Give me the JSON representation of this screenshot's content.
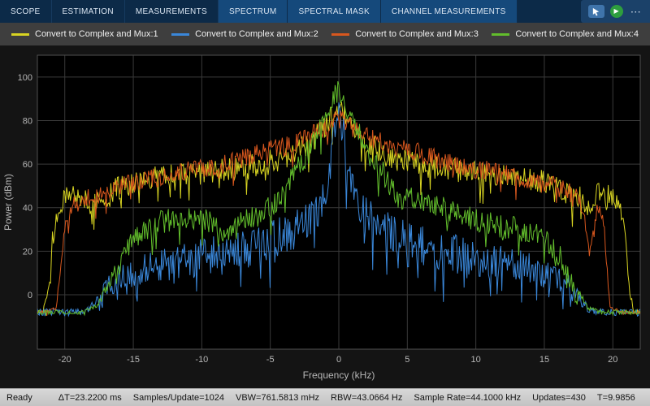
{
  "tabs": [
    "SCOPE",
    "ESTIMATION",
    "MEASUREMENTS",
    "SPECTRUM",
    "SPECTRAL MASK",
    "CHANNEL MEASUREMENTS"
  ],
  "toolbar": {
    "play_glyph": "▶",
    "more_glyph": "⋯",
    "icons": [
      "pointer-badge-icon",
      "run-play-icon",
      "more-options-icon"
    ]
  },
  "legend": [
    {
      "label": "Convert to Complex and Mux:1",
      "color": "#d8d422"
    },
    {
      "label": "Convert to Complex and Mux:2",
      "color": "#3a87d9"
    },
    {
      "label": "Convert to Complex and Mux:3",
      "color": "#d8571e"
    },
    {
      "label": "Convert to Complex and Mux:4",
      "color": "#62bd2c"
    }
  ],
  "status": {
    "ready": "Ready",
    "items": [
      "ΔT=23.2200 ms",
      "Samples/Update=1024",
      "VBW=761.5813 mHz",
      "RBW=43.0664 Hz",
      "Sample Rate=44.1000 kHz",
      "Updates=430",
      "T=9.9856"
    ]
  },
  "chart_data": {
    "type": "line",
    "title": "",
    "xlabel": "Frequency (kHz)",
    "ylabel": "Power (dBm)",
    "xlim": [
      -22,
      22
    ],
    "ylim": [
      -25,
      110
    ],
    "xticks": [
      -20,
      -15,
      -10,
      -5,
      0,
      5,
      10,
      15,
      20
    ],
    "yticks": [
      0,
      20,
      40,
      60,
      80,
      100
    ],
    "grid": true,
    "legend_position": "top",
    "colors": {
      "figure_bg": "#141414",
      "axes_bg": "#000000",
      "grid": "#3a3a3a",
      "tick_text": "#b6b6b6",
      "border": "#4f4f4f"
    },
    "series": [
      {
        "name": "Convert to Complex and Mux:1",
        "color": "#d8d422",
        "noise": 5.5,
        "x": [
          -22,
          -21.6,
          -21.2,
          -20.9,
          -20.5,
          -20,
          -19.5,
          -19,
          -18.5,
          -18,
          -17.5,
          -17,
          -16.3,
          -15.6,
          -14.9,
          -14.2,
          -13.5,
          -12.8,
          -12.1,
          -11.4,
          -10.7,
          -10,
          -9.3,
          -8.6,
          -7.9,
          -7.2,
          -6.5,
          -5.8,
          -5.1,
          -4.5,
          -3.9,
          -3.3,
          -2.8,
          -2.3,
          -1.9,
          -1.5,
          -1.1,
          -0.8,
          -0.5,
          -0.25,
          0,
          0.25,
          0.5,
          0.8,
          1.1,
          1.5,
          1.9,
          2.3,
          2.8,
          3.3,
          3.9,
          4.5,
          5.1,
          5.8,
          6.5,
          7.2,
          7.9,
          8.6,
          9.3,
          10,
          10.7,
          11.4,
          12.1,
          12.8,
          13.5,
          14.2,
          14.9,
          15.6,
          16.3,
          17,
          17.5,
          18,
          18.5,
          19,
          19.5,
          20,
          20.5,
          20.9,
          21.2,
          21.6,
          22
        ],
        "y": [
          -8,
          -8,
          2,
          25,
          40,
          44,
          46,
          47,
          43,
          40,
          46,
          44,
          48,
          50,
          52,
          53,
          54,
          54,
          55,
          55,
          56,
          56,
          57,
          57,
          58,
          58,
          59,
          60,
          61,
          62,
          63,
          65,
          67,
          69,
          71,
          74,
          77,
          80,
          82,
          84,
          85,
          84,
          82,
          80,
          77,
          74,
          71,
          69,
          67,
          65,
          63,
          62,
          61,
          60,
          59,
          58,
          58,
          57,
          57,
          56,
          56,
          55,
          55,
          54,
          54,
          53,
          52,
          50,
          48,
          44,
          46,
          40,
          43,
          47,
          46,
          44,
          40,
          25,
          2,
          -8,
          -8
        ]
      },
      {
        "name": "Convert to Complex and Mux:2",
        "color": "#3a87d9",
        "noise": 9,
        "x": [
          -22,
          -21,
          -20,
          -19,
          -18.3,
          -17.8,
          -17.3,
          -16.8,
          -16.1,
          -15.4,
          -14.7,
          -14,
          -13.2,
          -12.4,
          -11.6,
          -10.8,
          -10,
          -9.2,
          -8.4,
          -7.6,
          -6.8,
          -6,
          -5.3,
          -4.6,
          -4,
          -3.4,
          -2.9,
          -2.4,
          -2,
          -1.6,
          -1.25,
          -0.95,
          -0.7,
          -0.5,
          -0.32,
          -0.18,
          -0.08,
          0,
          0.08,
          0.18,
          0.32,
          0.5,
          0.7,
          0.95,
          1.25,
          1.6,
          2,
          2.4,
          2.9,
          3.4,
          4,
          4.6,
          5.3,
          6,
          6.8,
          7.6,
          8.4,
          9.2,
          10,
          10.8,
          11.6,
          12.4,
          13.2,
          14,
          14.7,
          15.4,
          16.1,
          16.8,
          17.3,
          17.8,
          18.3,
          19,
          20,
          21,
          22
        ],
        "y": [
          -8,
          -8,
          -8,
          -8,
          -7,
          -4,
          1,
          4,
          7,
          9,
          10,
          12,
          13,
          14,
          15,
          16,
          17,
          18,
          19,
          20,
          21,
          23,
          24,
          26,
          28,
          30,
          32,
          34,
          36,
          39,
          43,
          48,
          56,
          65,
          74,
          81,
          84,
          85,
          84,
          81,
          74,
          65,
          56,
          48,
          43,
          39,
          36,
          34,
          32,
          30,
          28,
          26,
          24,
          23,
          21,
          20,
          19,
          18,
          17,
          16,
          15,
          14,
          13,
          12,
          10,
          9,
          7,
          4,
          1,
          -4,
          -7,
          -8,
          -8,
          -8,
          -8
        ]
      },
      {
        "name": "Convert to Complex and Mux:3",
        "color": "#d8571e",
        "noise": 4.5,
        "x": [
          -22,
          -21.5,
          -21,
          -20.6,
          -20.2,
          -19.8,
          -19.3,
          -18.8,
          -18.3,
          -17.8,
          -17.2,
          -16.6,
          -16,
          -15.3,
          -14.6,
          -13.9,
          -13.2,
          -12.5,
          -11.8,
          -11.1,
          -10.4,
          -9.7,
          -9,
          -8.3,
          -7.6,
          -6.9,
          -6.2,
          -5.5,
          -4.9,
          -4.3,
          -3.7,
          -3.2,
          -2.7,
          -2.2,
          -1.8,
          -1.4,
          -1,
          -0.7,
          -0.4,
          -0.2,
          0,
          0.2,
          0.4,
          0.7,
          1,
          1.4,
          1.8,
          2.2,
          2.7,
          3.2,
          3.7,
          4.3,
          4.9,
          5.5,
          6.2,
          6.9,
          7.6,
          8.3,
          9,
          9.7,
          10.4,
          11.1,
          11.8,
          12.5,
          13.2,
          13.9,
          14.6,
          15.3,
          16,
          16.6,
          17.2,
          17.8,
          18.3,
          18.8,
          19.3,
          19.8,
          20.2,
          20.6,
          21,
          21.5,
          22
        ],
        "y": [
          -8,
          -8,
          -7,
          -6,
          20,
          36,
          41,
          44,
          45,
          46,
          47,
          48,
          49,
          51,
          52,
          53,
          54,
          55,
          56,
          57,
          57,
          58,
          59,
          60,
          61,
          63,
          64,
          66,
          67,
          68,
          69,
          70,
          71,
          73,
          74,
          76,
          77,
          78,
          79,
          80,
          80,
          80,
          79,
          78,
          77,
          76,
          74,
          73,
          71,
          70,
          69,
          68,
          67,
          66,
          64,
          63,
          61,
          60,
          59,
          58,
          57,
          57,
          56,
          55,
          54,
          53,
          52,
          51,
          49,
          48,
          45,
          42,
          20,
          38,
          35,
          -5,
          -7,
          -8,
          -8,
          -8,
          -8
        ]
      },
      {
        "name": "Convert to Complex and Mux:4",
        "color": "#62bd2c",
        "noise": 5.5,
        "x": [
          -22,
          -21,
          -20,
          -19,
          -18.2,
          -17.7,
          -17.3,
          -16.9,
          -16.5,
          -16,
          -15.5,
          -15,
          -14.4,
          -13.8,
          -13.2,
          -12.6,
          -12,
          -11.4,
          -10.8,
          -10.2,
          -9.6,
          -9,
          -8.5,
          -8,
          -7.5,
          -7,
          -6.5,
          -6,
          -5.5,
          -5,
          -4.6,
          -4.2,
          -3.8,
          -3.4,
          -3,
          -2.7,
          -2.4,
          -2.1,
          -1.8,
          -1.55,
          -1.3,
          -1.1,
          -0.9,
          -0.7,
          -0.5,
          -0.35,
          -0.2,
          -0.1,
          0,
          0.1,
          0.2,
          0.35,
          0.5,
          0.7,
          0.9,
          1.1,
          1.3,
          1.55,
          1.8,
          2.1,
          2.4,
          2.7,
          3,
          3.4,
          3.8,
          4.2,
          4.6,
          5,
          5.5,
          6,
          6.5,
          7,
          7.5,
          8,
          8.5,
          9,
          9.6,
          10.2,
          10.8,
          11.4,
          12,
          12.6,
          13.2,
          13.8,
          14.4,
          15,
          15.5,
          16,
          16.5,
          16.9,
          17.3,
          17.7,
          18.2,
          19,
          20,
          21,
          22
        ],
        "y": [
          -8,
          -8,
          -8,
          -8,
          -7,
          -5,
          -1,
          3,
          8,
          14,
          20,
          25,
          29,
          31,
          33,
          34,
          34,
          35,
          35,
          35,
          34,
          32,
          30,
          28,
          31,
          33,
          35,
          36,
          38,
          40,
          43,
          46,
          50,
          54,
          58,
          61,
          64,
          67,
          70,
          73,
          76,
          79,
          82,
          85,
          88,
          91,
          93,
          95,
          96,
          95,
          93,
          91,
          88,
          85,
          82,
          79,
          76,
          73,
          70,
          67,
          64,
          61,
          58,
          54,
          50,
          46,
          44,
          45,
          44,
          43,
          42,
          41,
          40,
          39,
          38,
          36,
          35,
          34,
          33,
          32,
          31,
          31,
          30,
          29,
          28,
          26,
          23,
          19,
          13,
          8,
          3,
          -1,
          -6,
          -8,
          -8,
          -8,
          -8
        ]
      }
    ]
  }
}
